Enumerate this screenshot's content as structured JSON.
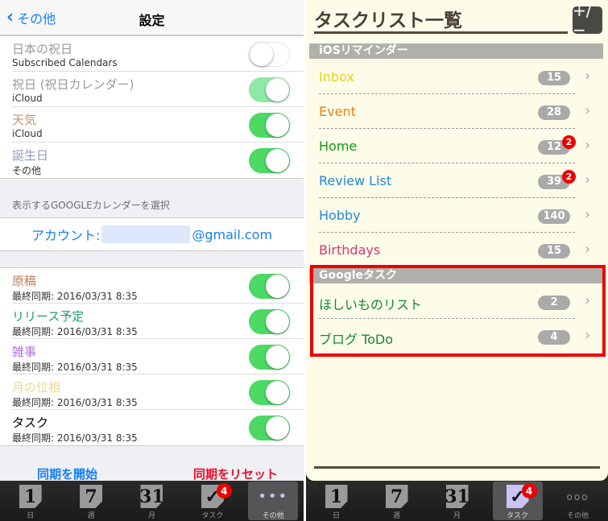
{
  "left": {
    "nav": {
      "back": "その他",
      "title": "設定"
    },
    "calendars": [
      {
        "name": "日本の祝日",
        "source": "Subscribed Calendars",
        "color": "#999999",
        "on": false
      },
      {
        "name": "祝日 (祝日カレンダー)",
        "source": "iCloud",
        "color": "#999999",
        "on": true,
        "dim": true
      },
      {
        "name": "天気",
        "source": "iCloud",
        "color": "#c0956a",
        "on": true
      },
      {
        "name": "誕生日",
        "source": "その他",
        "color": "#8aa0c0",
        "on": true
      }
    ],
    "google_header": "表示するGOOGLEカレンダーを選択",
    "account_label": "アカウント:",
    "account_domain": "@gmail.com",
    "google_cals": [
      {
        "name": "原稿",
        "sync": "最終同期: 2016/03/31 8:35",
        "color": "#c07a55",
        "on": true
      },
      {
        "name": "リリース予定",
        "sync": "最終同期: 2016/03/31 8:35",
        "color": "#1aa06b",
        "on": true
      },
      {
        "name": "雑事",
        "sync": "最終同期: 2016/03/31 8:35",
        "color": "#b070d8",
        "on": true
      },
      {
        "name": "月の位相",
        "sync": "最終同期: 2016/03/31 8:35",
        "color": "#ecd98e",
        "on": true
      },
      {
        "name": "タスク",
        "sync": "最終同期: 2016/03/31 8:35",
        "color": "#000000",
        "on": true
      }
    ],
    "start_sync": "同期を開始",
    "reset_sync": "同期をリセット"
  },
  "tabs": [
    {
      "icon": "1",
      "label": "日"
    },
    {
      "icon": "7",
      "label": "週"
    },
    {
      "icon": "31",
      "label": "月"
    },
    {
      "icon": "✓",
      "label": "タスク",
      "badge": "4"
    },
    {
      "icon": "•••",
      "label": "その他"
    }
  ],
  "right": {
    "title": "タスクリスト一覧",
    "plusminus": "+/−",
    "ios_header": "iOSリマインダー",
    "ios_lists": [
      {
        "name": "Inbox",
        "count": "15",
        "color": "#e0d020"
      },
      {
        "name": "Event",
        "count": "28",
        "color": "#f08010"
      },
      {
        "name": "Home",
        "count": "12",
        "badge": "2",
        "color": "#119911"
      },
      {
        "name": "Review List",
        "count": "39",
        "badge": "2",
        "color": "#2288dd"
      },
      {
        "name": "Hobby",
        "count": "140",
        "color": "#2288dd"
      },
      {
        "name": "Birthdays",
        "count": "15",
        "color": "#dd3377"
      }
    ],
    "google_header": "Googleタスク",
    "google_lists": [
      {
        "name": "ほしいものリスト",
        "count": "2",
        "color": "#118833"
      },
      {
        "name": "ブログ ToDo",
        "count": "4",
        "color": "#118833"
      }
    ]
  }
}
